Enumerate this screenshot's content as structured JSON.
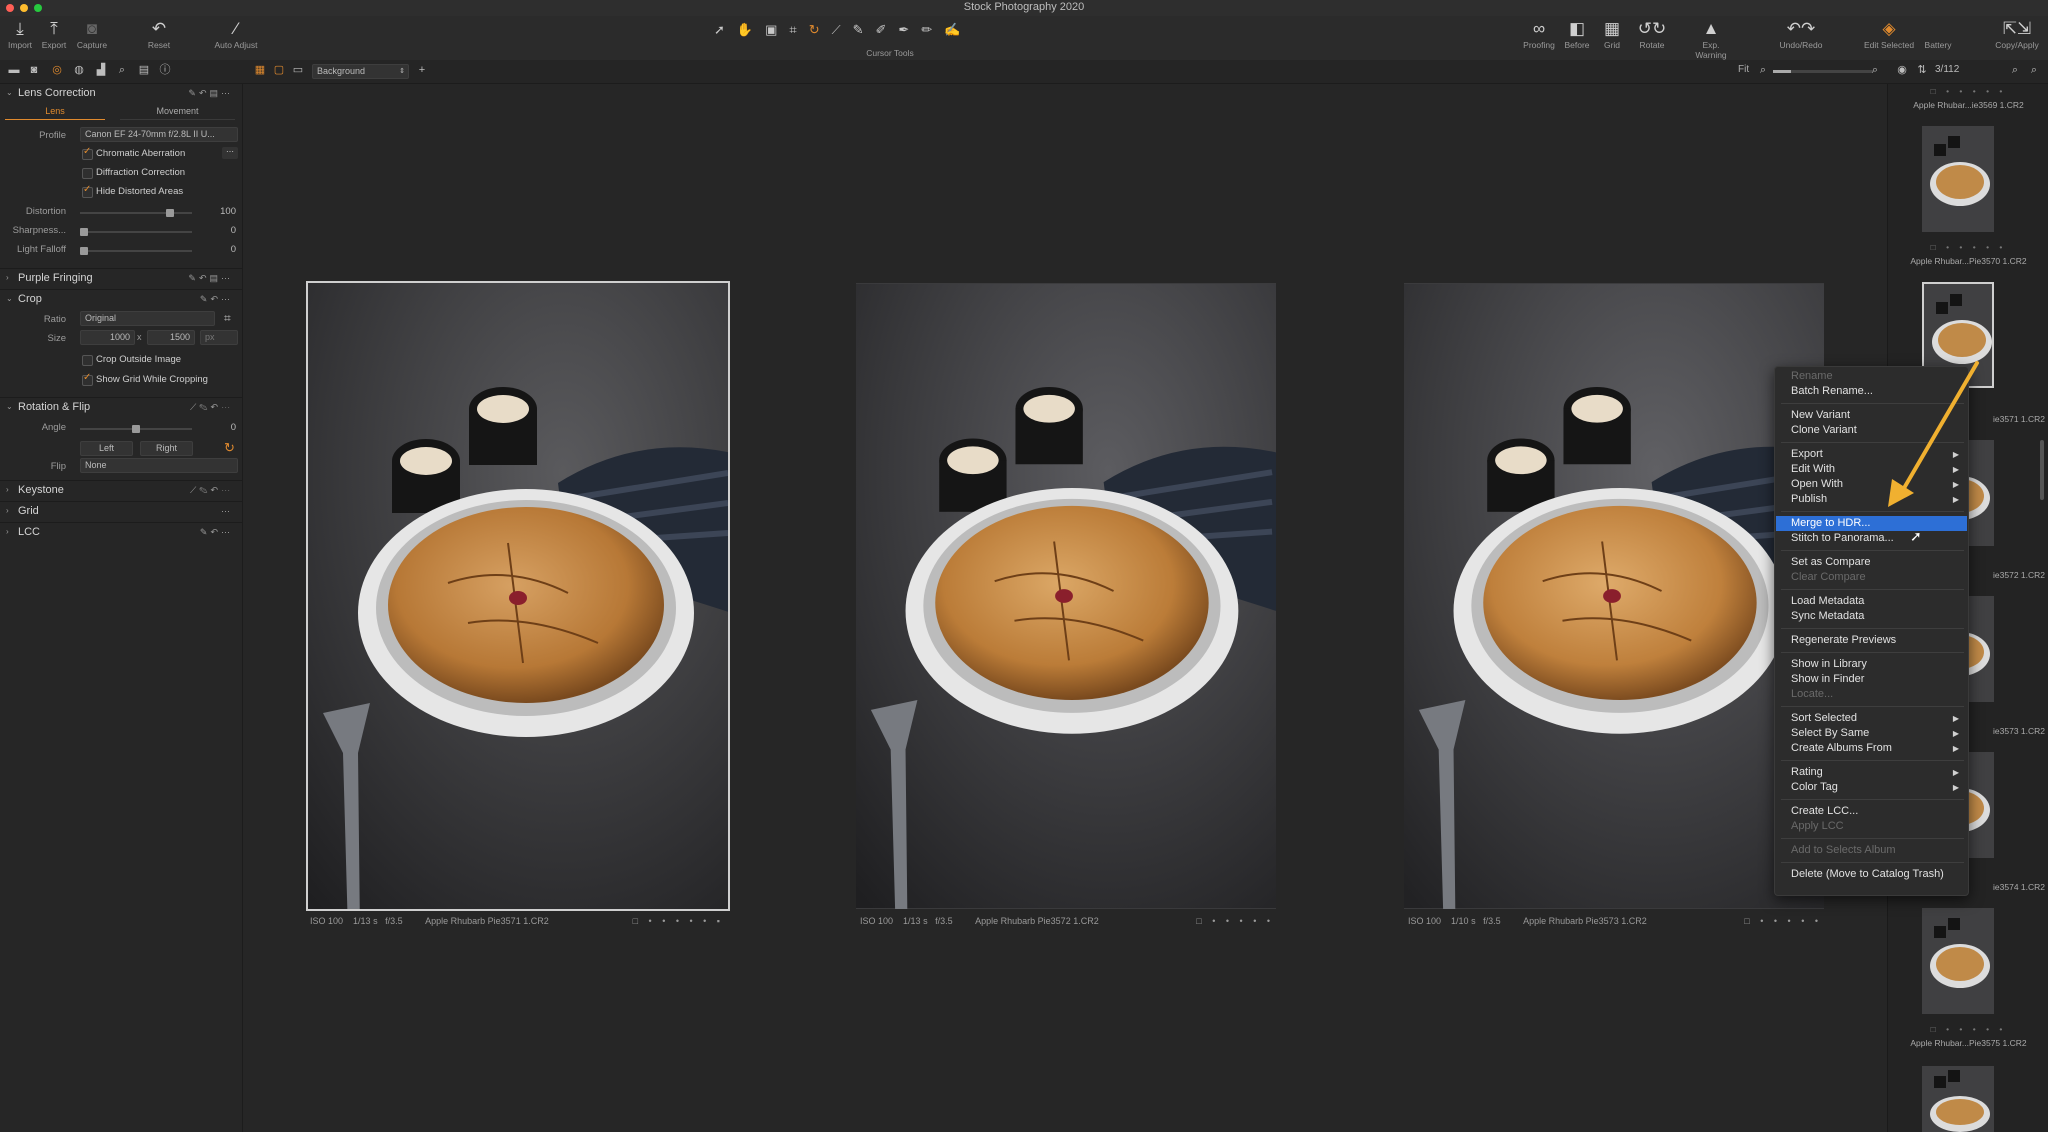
{
  "window": {
    "title": "Stock Photography 2020"
  },
  "toolbar": {
    "import": "Import",
    "export": "Export",
    "capture": "Capture",
    "reset": "Reset",
    "auto_adjust": "Auto Adjust",
    "cursor_tools": "Cursor Tools",
    "proofing": "Proofing",
    "before": "Before",
    "grid": "Grid",
    "rotate": "Rotate",
    "exp_warning": "Exp. Warning",
    "undo_redo": "Undo/Redo",
    "edit_selected": "Edit Selected",
    "battery": "Battery",
    "copy_apply": "Copy/Apply"
  },
  "viewer_bar": {
    "background": "Background",
    "fit": "Fit",
    "counter": "3/112"
  },
  "lens_correction": {
    "title": "Lens Correction",
    "tabs": [
      "Lens",
      "Movement"
    ],
    "profile_label": "Profile",
    "profile_value": "Canon EF 24-70mm f/2.8L II U...",
    "chromatic": "Chromatic Aberration",
    "diffraction": "Diffraction Correction",
    "hide_distorted": "Hide Distorted Areas",
    "distortion_label": "Distortion",
    "distortion_value": "100",
    "distortion_level": 1.0,
    "sharpness_label": "Sharpness...",
    "sharpness_value": "0",
    "falloff_label": "Light Falloff",
    "falloff_value": "0"
  },
  "purple_fringing": {
    "title": "Purple Fringing"
  },
  "crop": {
    "title": "Crop",
    "ratio_label": "Ratio",
    "ratio_value": "Original",
    "size_label": "Size",
    "width": "1000",
    "x": "x",
    "height": "1500",
    "unit": "px",
    "crop_outside": "Crop Outside Image",
    "show_grid": "Show Grid While Cropping"
  },
  "rotation": {
    "title": "Rotation & Flip",
    "angle_label": "Angle",
    "angle_value": "0",
    "left": "Left",
    "right": "Right",
    "flip_label": "Flip",
    "flip_value": "None"
  },
  "keystone": {
    "title": "Keystone"
  },
  "grid_section": {
    "title": "Grid"
  },
  "lcc": {
    "title": "LCC"
  },
  "photos": [
    {
      "iso": "ISO 100",
      "shutter": "1/13 s",
      "aperture": "f/3.5",
      "name": "Apple Rhubarb Pie3571 1.CR2"
    },
    {
      "iso": "ISO 100",
      "shutter": "1/13 s",
      "aperture": "f/3.5",
      "name": "Apple Rhubarb Pie3572 1.CR2"
    },
    {
      "iso": "ISO 100",
      "shutter": "1/10 s",
      "aperture": "f/3.5",
      "name": "Apple Rhubarb Pie3573 1.CR2"
    }
  ],
  "browser": {
    "names": [
      "Apple Rhubar...ie3569 1.CR2",
      "Apple Rhubar...Pie3570 1.CR2",
      "ie3571 1.CR2",
      "ie3572 1.CR2",
      "ie3573 1.CR2",
      "ie3574 1.CR2",
      "Apple Rhubar...Pie3575 1.CR2"
    ]
  },
  "context_menu": {
    "rename": "Rename",
    "batch_rename": "Batch Rename...",
    "new_variant": "New Variant",
    "clone_variant": "Clone Variant",
    "export": "Export",
    "edit_with": "Edit With",
    "open_with": "Open With",
    "publish": "Publish",
    "merge_hdr": "Merge to HDR...",
    "stitch": "Stitch to Panorama...",
    "set_compare": "Set as Compare",
    "clear_compare": "Clear Compare",
    "load_metadata": "Load Metadata",
    "sync_metadata": "Sync Metadata",
    "regenerate": "Regenerate Previews",
    "show_library": "Show in Library",
    "show_finder": "Show in Finder",
    "locate": "Locate...",
    "sort_selected": "Sort Selected",
    "select_same": "Select By Same",
    "create_albums": "Create Albums From",
    "rating": "Rating",
    "color_tag": "Color Tag",
    "create_lcc": "Create LCC...",
    "apply_lcc": "Apply LCC",
    "add_album": "Add to Selects Album",
    "delete": "Delete (Move to Catalog Trash)"
  },
  "colors": {
    "accent": "#e08a2e",
    "highlight": "#2d6fd6",
    "arrow": "#f0b030"
  }
}
